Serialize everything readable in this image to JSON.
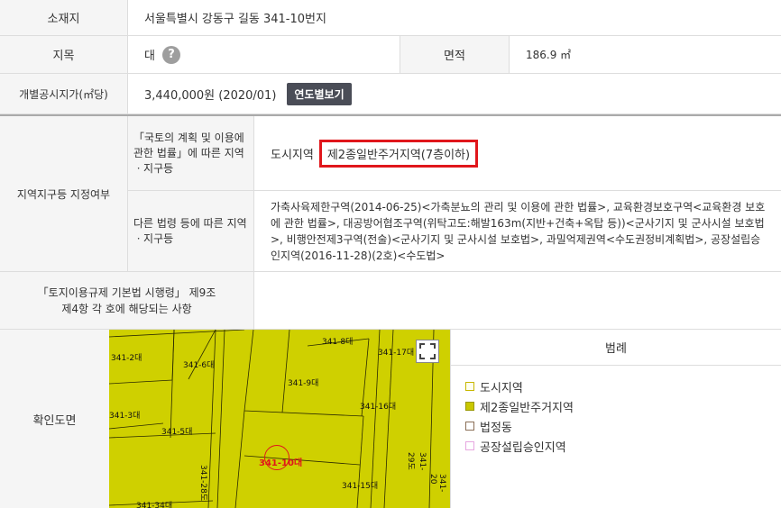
{
  "rows": {
    "location": {
      "label": "소재지",
      "value": "서울특별시 강동구 길동 341-10번지"
    },
    "land": {
      "label": "지목",
      "value": "대",
      "help_icon": "?",
      "area_label": "면적",
      "area_value": "186.9 ㎡"
    },
    "price": {
      "label": "개별공시지가(㎡당)",
      "value": "3,440,000원 (2020/01)",
      "button": "연도별보기"
    },
    "zoning": {
      "label": "지역지구등 지정여부",
      "national_label": "「국토의 계획 및 이용에 관한 법률」에 따른 지역ㆍ지구등",
      "national_prefix": "도시지역",
      "national_value": "제2종일반주거지역(7층이하)",
      "other_label": "다른 법령 등에 따른 지역ㆍ지구등",
      "other_value": "가축사육제한구역(2014-06-25)<가축분뇨의 관리 및 이용에 관한 법률>, 교육환경보호구역<교육환경 보호에 관한 법률>, 대공방어협조구역(위탁고도:해발163m(지반+건축+옥탑 등))<군사기지 및 군사시설 보호법>, 비행안전제3구역(전술)<군사기지 및 군사시설 보호법>, 과밀억제권역<수도권정비계획법>, 공장설립승인지역(2016-11-28)(2호)<수도법>"
    },
    "act": {
      "label": "「토지이용규제 기본법 시행령」 제9조 제4항 각 호에 해당되는 사항",
      "value": ""
    },
    "map": {
      "label": "확인도면",
      "legend_title": "범례",
      "legend": [
        {
          "label": "도시지역",
          "color": "#f5f0a0",
          "border": "#c8b800"
        },
        {
          "label": "제2종일반주거지역",
          "color": "#c9c800",
          "border": "#9a9800"
        },
        {
          "label": "법정동",
          "color": "#ffffff",
          "border": "#8b6f57"
        },
        {
          "label": "공장설립승인지역",
          "color": "#ffffff",
          "border": "#e7a7e0"
        }
      ],
      "parcels": [
        "341-8대",
        "341-17대",
        "341-2대",
        "341-6대",
        "341-9대",
        "341-3대",
        "341-16대",
        "341-5대",
        "341-10대",
        "341-15대",
        "341-34대",
        "341-28도",
        "341-29도",
        "341-20"
      ]
    }
  },
  "colors": {
    "map_fill": "#cfd000",
    "highlight": "#e0161b"
  }
}
